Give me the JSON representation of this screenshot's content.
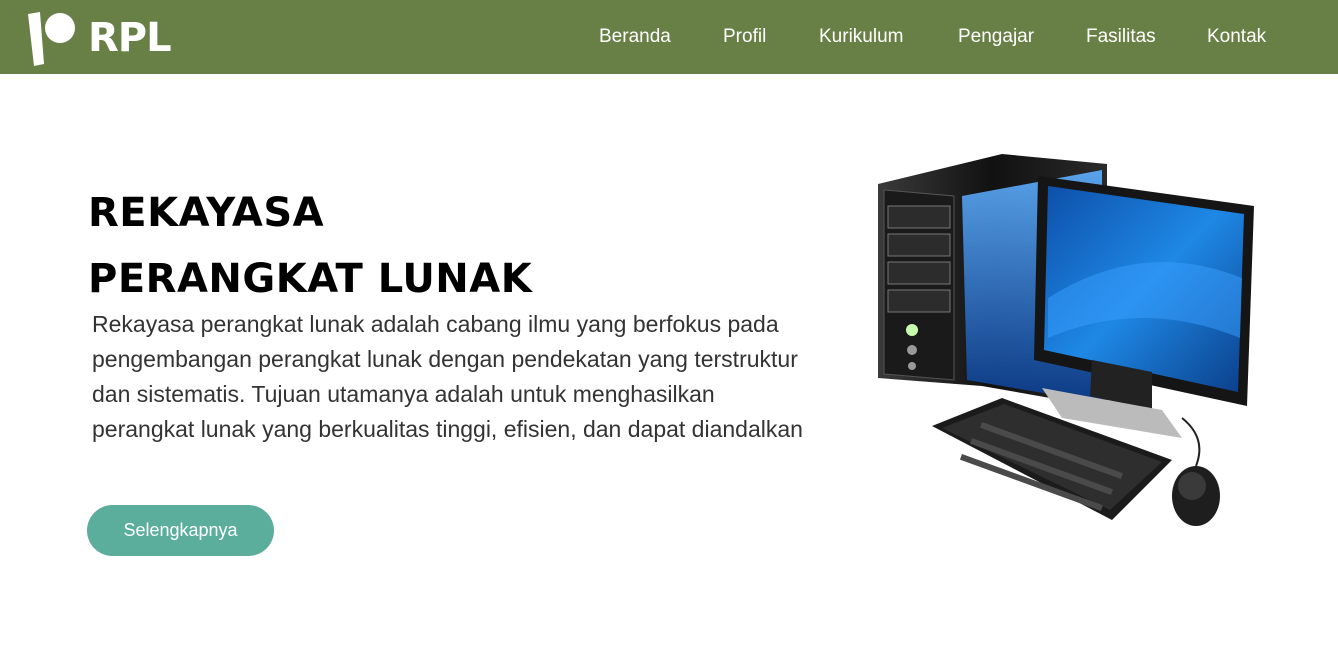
{
  "brand": {
    "name": "RPL"
  },
  "nav": {
    "items": [
      {
        "label": "Beranda"
      },
      {
        "label": "Profil"
      },
      {
        "label": "Kurikulum"
      },
      {
        "label": "Pengajar"
      },
      {
        "label": "Fasilitas"
      },
      {
        "label": "Kontak"
      }
    ]
  },
  "hero": {
    "title_line1": "REKAYASA",
    "title_line2": "PERANGKAT LUNAK",
    "description": "Rekayasa perangkat lunak adalah cabang ilmu yang berfokus pada pengembangan perangkat lunak dengan pendekatan yang terstruktur dan sistematis. Tujuan utamanya adalah untuk menghasilkan perangkat lunak yang berkualitas tinggi, efisien, dan dapat diandalkan",
    "cta_label": "Selengkapnya",
    "image_icon": "desktop-computer-illustration"
  },
  "colors": {
    "navbar": "#687f46",
    "cta": "#5aae9b",
    "text_dark": "#000000",
    "text_body": "#333333"
  }
}
